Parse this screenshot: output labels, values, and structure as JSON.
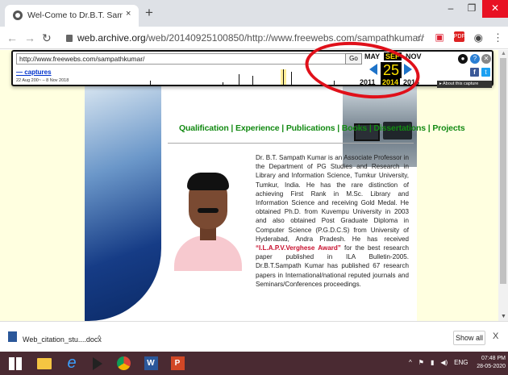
{
  "browser": {
    "tab_title": "Wel-Come to Dr.B.T. Sampath Ku",
    "new_tab_label": "+",
    "tab_close": "×",
    "url_host": "web.archive.org",
    "url_path": "/web/20140925100850/http://www.freewebs.com/sampathkumar/"
  },
  "wayback": {
    "url_value": "http://www.freewebs.com/sampathkumar/",
    "go_label": "Go",
    "captures_link": "— captures",
    "date_range": "22 Aug 200~ – 8 Nov 2018",
    "months": [
      "MAY",
      "SEP",
      "NOV"
    ],
    "day": "25",
    "years": [
      "2011",
      "2014",
      "2018"
    ],
    "about_label": "▸ About this capture"
  },
  "page": {
    "nav_links": "Qualification | Experience | Publications | Books | Dissertations | Projects",
    "bio_before_award": "Dr. B.T. Sampath Kumar is an Associate Professor in the Department of PG Studies and Research in Library and Information Science, Tumkur University, Tumkur, India. He has the rare distinction of achieving First Rank in M.Sc. Library and Information Science and receiving Gold Medal. He obtained Ph.D. from Kuvempu University in 2003 and also obtained Post Graduate Diploma in Computer Science (P.G.D.C.S) from University of Hyderabad, Andra Pradesh. He has received ",
    "bio_award": "“I.L.A.P.V.Verghese Award”",
    "bio_after_award": " for the best research paper published in ILA Bulletin-2005. Dr.B.T.Sampath Kumar has published 67 research papers in International/national reputed journals and Seminars/Conferences proceedings."
  },
  "downloads": {
    "file_name": "Web_citation_stu....docx",
    "show_all": "Show all",
    "close": "X"
  },
  "taskbar": {
    "language": "ENG",
    "time": "07:48 PM",
    "date": "28-05-2020"
  },
  "colors": {
    "link_green": "#138a13",
    "award_red": "#c8102e",
    "wayback_yellow": "#ffe200",
    "annotation_red": "#e0101a"
  },
  "icons": [
    "globe-icon",
    "back-icon",
    "forward-icon",
    "reload-icon",
    "lock-icon",
    "star-icon",
    "profile-icon",
    "menu-icon",
    "help-icon",
    "facebook-icon",
    "twitter-icon",
    "word-doc-icon",
    "windows-start-icon",
    "folder-icon",
    "ie-icon",
    "chrome-icon",
    "word-icon",
    "powerpoint-icon"
  ]
}
